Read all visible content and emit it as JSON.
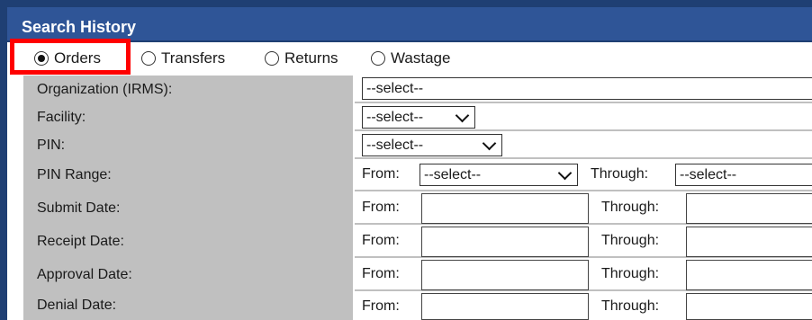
{
  "panel": {
    "title": "Search History"
  },
  "radios": [
    {
      "label": "Orders",
      "checked": true
    },
    {
      "label": "Transfers",
      "checked": false
    },
    {
      "label": "Returns",
      "checked": false
    },
    {
      "label": "Wastage",
      "checked": false
    }
  ],
  "rows": {
    "organization": {
      "label": "Organization (IRMS):",
      "value": "--select--"
    },
    "facility": {
      "label": "Facility:",
      "value": "--select--"
    },
    "pin": {
      "label": "PIN:",
      "value": "--select--"
    },
    "pin_range": {
      "label": "PIN Range:",
      "from_label": "From:",
      "from_value": "--select--",
      "through_label": "Through:",
      "through_value": "--select--"
    },
    "submit_date": {
      "label": "Submit Date:",
      "from_label": "From:",
      "through_label": "Through:"
    },
    "receipt_date": {
      "label": "Receipt Date:",
      "from_label": "From:",
      "through_label": "Through:"
    },
    "approval_date": {
      "label": "Approval Date:",
      "from_label": "From:",
      "through_label": "Through:"
    },
    "denial_date": {
      "label": "Denial Date:",
      "from_label": "From:",
      "through_label": "Through:"
    }
  },
  "colors": {
    "header": "#2f5597",
    "label_bg": "#c0c0c0",
    "highlight": "#ff0000"
  }
}
